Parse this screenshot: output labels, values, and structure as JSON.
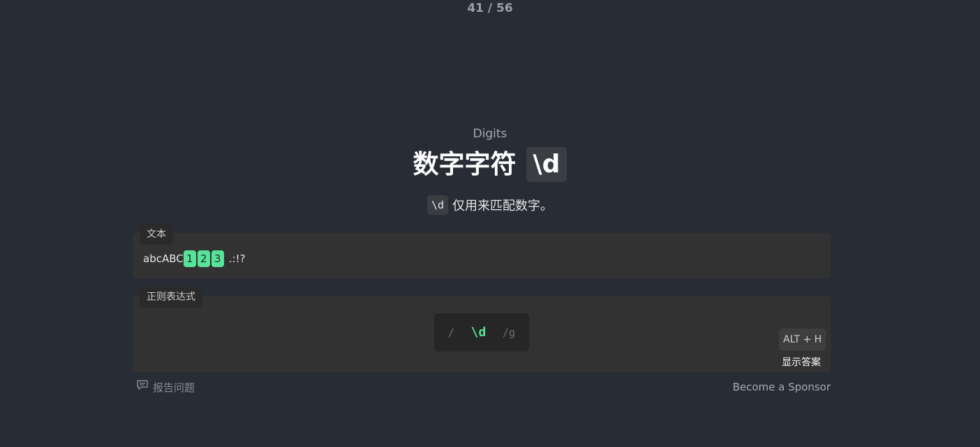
{
  "progress": "41 / 56",
  "lesson": {
    "subtitle": "Digits",
    "title": "数字字符",
    "title_code": "\\d",
    "desc_code": "\\d",
    "desc_text": "仅用来匹配数字。"
  },
  "text_panel": {
    "label": "文本",
    "prefix": "abcABC",
    "matches": [
      "1",
      "2",
      "3"
    ],
    "suffix": ".:!?"
  },
  "regex_panel": {
    "label": "正则表达式",
    "open_slash": "/",
    "value": "\\d",
    "flags": "/g",
    "shortcut": "ALT + H",
    "show_answer": "显示答案"
  },
  "footer": {
    "report": "报告问题",
    "sponsor": "Become a Sponsor"
  },
  "colors": {
    "background": "#282c34",
    "panel": "#323232",
    "match": "#58e39a"
  }
}
